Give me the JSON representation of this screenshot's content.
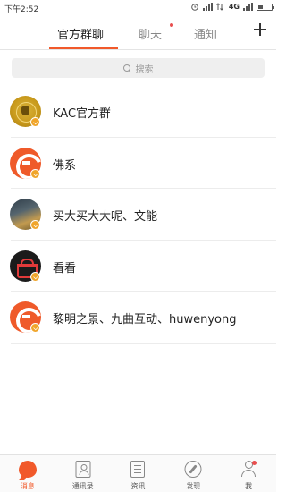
{
  "status_bar": {
    "time": "下午2:52",
    "network": "4G",
    "icons": [
      "alarm-icon",
      "signal-icon",
      "data-icon",
      "battery-icon"
    ]
  },
  "header": {
    "tabs": [
      {
        "label": "官方群聊",
        "active": true
      },
      {
        "label": "聊天",
        "active": false,
        "has_dot": true
      },
      {
        "label": "通知",
        "active": false
      }
    ],
    "add_icon": "plus-icon"
  },
  "search": {
    "placeholder": "搜索",
    "icon": "search-icon"
  },
  "groups": [
    {
      "name": "KAC官方群",
      "avatar": "gold-seal-avatar"
    },
    {
      "name": "佛系",
      "avatar": "orange-logo-avatar"
    },
    {
      "name": "买大买大大呢、文能",
      "avatar": "photo-avatar"
    },
    {
      "name": "看看",
      "avatar": "basket-avatar"
    },
    {
      "name": "黎明之景、九曲互动、huwenyong",
      "avatar": "orange-logo-avatar"
    }
  ],
  "bottom_nav": [
    {
      "label": "消息",
      "icon": "chat-bubble-icon",
      "active": true
    },
    {
      "label": "通讯录",
      "icon": "contacts-icon",
      "active": false
    },
    {
      "label": "资讯",
      "icon": "news-icon",
      "active": false
    },
    {
      "label": "发现",
      "icon": "compass-icon",
      "active": false
    },
    {
      "label": "我",
      "icon": "user-icon",
      "active": false,
      "has_dot": true
    }
  ],
  "colors": {
    "accent": "#f1592a",
    "badge": "#f0a52a",
    "dot": "#e84e4e"
  }
}
